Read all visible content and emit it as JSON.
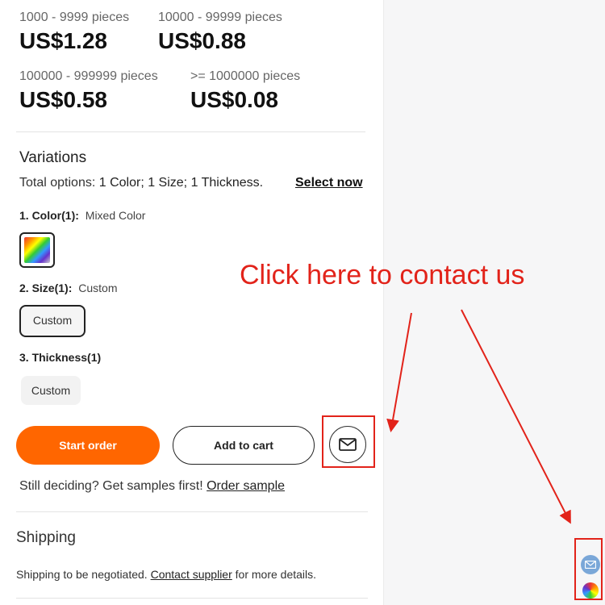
{
  "price_tiers": [
    {
      "qty": "1000 - 9999 pieces",
      "price": "US$1.28"
    },
    {
      "qty": "10000 - 99999 pieces",
      "price": "US$0.88"
    },
    {
      "qty": "100000 - 999999 pieces",
      "price": "US$0.58"
    },
    {
      "qty": ">= 1000000 pieces",
      "price": "US$0.08"
    }
  ],
  "variations": {
    "title": "Variations",
    "total_prefix": "Total options:",
    "total_value": "1 Color; 1 Size; 1 Thickness.",
    "select_now": "Select now",
    "color": {
      "label": "1. Color(1):",
      "value": "Mixed Color"
    },
    "size": {
      "label": "2. Size(1):",
      "value": "Custom",
      "option": "Custom"
    },
    "thickness": {
      "label": "3. Thickness(1)",
      "option": "Custom"
    }
  },
  "actions": {
    "start_order": "Start order",
    "add_to_cart": "Add to cart",
    "mail_icon": "mail-icon"
  },
  "samples": {
    "text": "Still deciding? Get samples first!",
    "link": "Order sample"
  },
  "shipping": {
    "title": "Shipping",
    "text_before": "Shipping to be negotiated.",
    "link": "Contact supplier",
    "text_after": "for more details."
  },
  "annotation": {
    "text": "Click here to contact us",
    "color": "#e2231a"
  },
  "colors": {
    "accent": "#ff6600",
    "annotation_red": "#e2231a"
  }
}
